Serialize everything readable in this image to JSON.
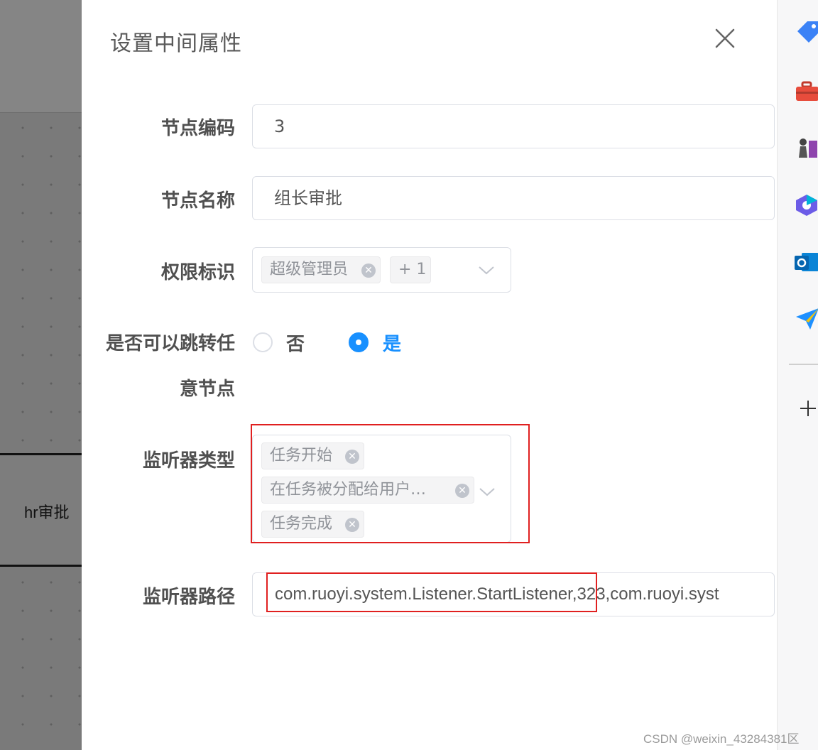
{
  "canvas": {
    "node_label": "hr审批"
  },
  "drawer": {
    "title": "设置中间属性",
    "close_icon": "close-icon"
  },
  "form": {
    "node_code": {
      "label": "节点编码",
      "value": "3"
    },
    "node_name": {
      "label": "节点名称",
      "value": "组长审批"
    },
    "permission": {
      "label": "权限标识",
      "tags": [
        "超级管理员"
      ],
      "more": "+ 1"
    },
    "jump": {
      "label_line1": "是否可以跳转任",
      "label_line2": "意节点",
      "options": [
        {
          "label": "否",
          "selected": false
        },
        {
          "label": "是",
          "selected": true
        }
      ]
    },
    "listener_type": {
      "label": "监听器类型",
      "tags": [
        "任务开始",
        "在任务被分配给用户…",
        "任务完成"
      ]
    },
    "listener_path": {
      "label": "监听器路径",
      "value": "com.ruoyi.system.Listener.StartListener,323,com.ruoyi.syst"
    }
  },
  "toolbar": {
    "icons": [
      "tag-icon",
      "toolbox-icon",
      "chess-icon",
      "copilot-icon",
      "outlook-icon",
      "send-icon",
      "add-icon"
    ]
  },
  "watermark": "CSDN @weixin_43284381区",
  "colors": {
    "accent": "#1890ff",
    "highlight_box": "#e02020",
    "label": "#505050"
  }
}
